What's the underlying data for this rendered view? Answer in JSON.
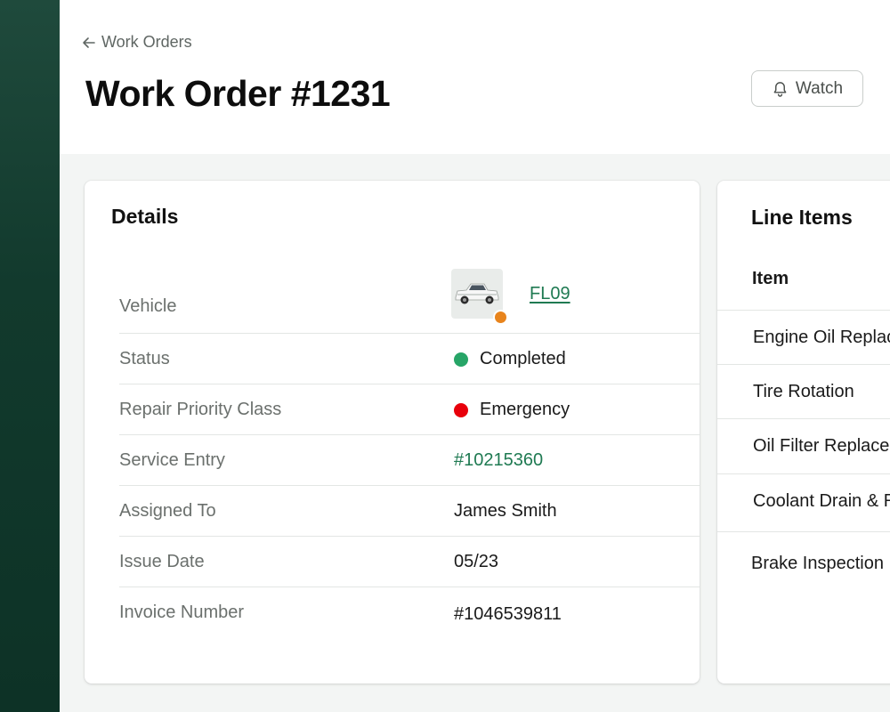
{
  "header": {
    "back_label": "Work Orders",
    "title": "Work Order #1231",
    "watch_label": "Watch"
  },
  "details": {
    "title": "Details",
    "vehicle": {
      "label": "Vehicle",
      "value": "FL09",
      "status_color": "#e8841c"
    },
    "status": {
      "label": "Status",
      "value": "Completed",
      "color": "#27a567"
    },
    "priority": {
      "label": "Repair Priority Class",
      "value": "Emergency",
      "color": "#e8000b"
    },
    "service_entry": {
      "label": "Service Entry",
      "value": "#10215360"
    },
    "assigned_to": {
      "label": "Assigned To",
      "value": "James Smith"
    },
    "issue_date": {
      "label": "Issue Date",
      "value": "05/23"
    },
    "invoice": {
      "label": "Invoice Number",
      "value": "#1046539811"
    }
  },
  "line_items": {
    "title": "Line Items",
    "column_header": "Item",
    "items": [
      "Engine Oil Replacement",
      "Tire Rotation",
      "Oil Filter Replacement",
      "Coolant Drain & Refill",
      "Brake Inspection"
    ]
  },
  "colors": {
    "sidebar": "#123a2d",
    "accent_link": "#1f7a52"
  }
}
